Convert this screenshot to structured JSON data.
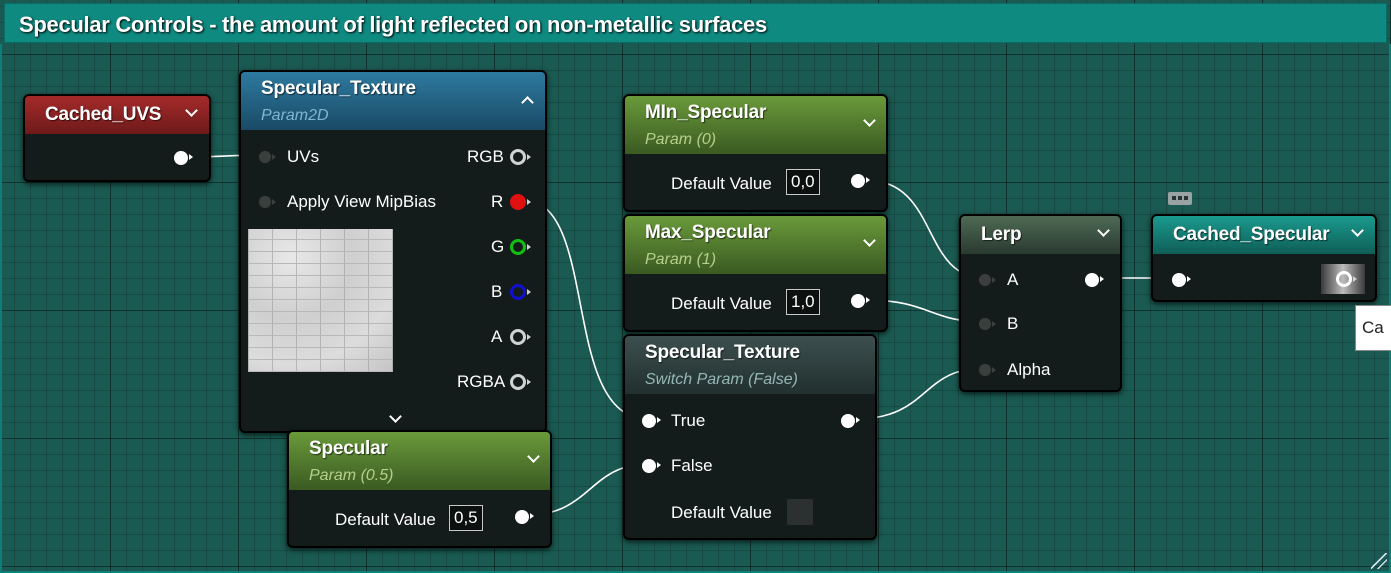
{
  "comment": {
    "title": "Specular Controls - the amount of light reflected on non-metallic surfaces"
  },
  "cached_uvs": {
    "title": "Cached_UVS"
  },
  "specular_texture_param": {
    "title": "Specular_Texture",
    "subtitle": "Param2D",
    "inputs": [
      "UVs",
      "Apply View MipBias"
    ],
    "outputs": [
      "RGB",
      "R",
      "G",
      "B",
      "A",
      "RGBA"
    ]
  },
  "min_specular": {
    "title": "MIn_Specular",
    "subtitle": "Param (0)",
    "default_label": "Default Value",
    "default_value": "0,0"
  },
  "max_specular": {
    "title": "Max_Specular",
    "subtitle": "Param (1)",
    "default_label": "Default Value",
    "default_value": "1,0"
  },
  "switch_param": {
    "title": "Specular_Texture",
    "subtitle": "Switch Param (False)",
    "inputs": [
      "True",
      "False"
    ],
    "default_label": "Default Value"
  },
  "specular": {
    "title": "Specular",
    "subtitle": "Param (0.5)",
    "default_label": "Default Value",
    "default_value": "0,5"
  },
  "lerp": {
    "title": "Lerp",
    "inputs": [
      "A",
      "B",
      "Alpha"
    ]
  },
  "cached_specular": {
    "title": "Cached_Specular"
  },
  "tooltip": {
    "text": "Ca"
  },
  "colors": {
    "comment": "#0f8a80",
    "red_header": "#8c2222",
    "blue_header": "#2a6e8c",
    "green_header": "#5b8a2e",
    "teal_header": "#0f8a80",
    "pin_r": "#e01010",
    "pin_g": "#10c010",
    "pin_b": "#1010d0"
  }
}
